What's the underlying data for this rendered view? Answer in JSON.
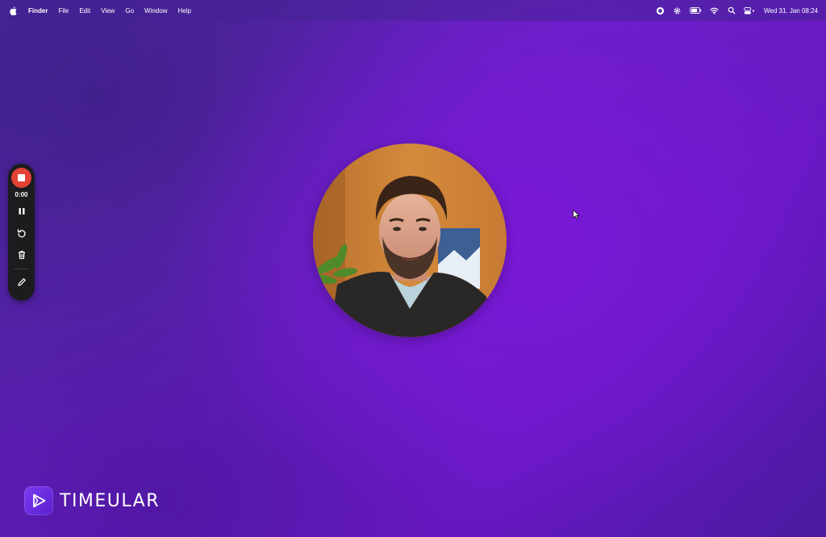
{
  "menubar": {
    "app_name": "Finder",
    "menus": [
      "File",
      "Edit",
      "View",
      "Go",
      "Window",
      "Help"
    ],
    "clock": "Wed 31. Jan  08:24"
  },
  "recorder": {
    "timer": "0:00",
    "stop_color": "#e34234"
  },
  "brand": {
    "name": "TIMEULAR"
  }
}
